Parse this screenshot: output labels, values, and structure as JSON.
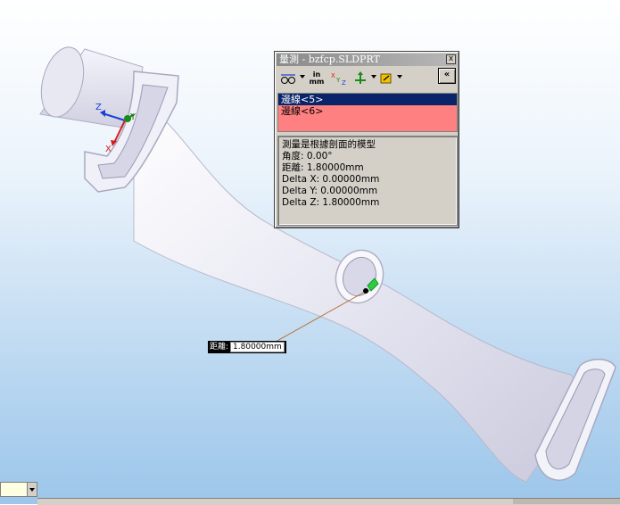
{
  "dialog": {
    "title": "量測 - bzfcp.SLDPRT",
    "close_glyph": "x",
    "collapse_glyph": "«",
    "toolbar": {
      "arc_icon": "arc-condition-icon",
      "units_label_top": "in",
      "units_label_bottom": "mm",
      "xyz_label": "XYZ",
      "projection_icon": "projection-icon",
      "coordinate_icon": "coordinate-system-icon"
    },
    "selections": [
      {
        "label": "邊線<5>",
        "selected": true
      },
      {
        "label": "邊線<6>",
        "selected": false
      }
    ],
    "results": [
      "測量是根據剖面的模型",
      "角度: 0.00°",
      "距離: 1.80000mm",
      "Delta X: 0.00000mm",
      "Delta Y: 0.00000mm",
      "Delta Z: 1.80000mm"
    ]
  },
  "callout": {
    "label": "距離:",
    "value": "1.80000mm"
  },
  "triad": {
    "x": "X",
    "y": "Y",
    "z": "Z"
  },
  "colors": {
    "selection_bg": "#ff8080",
    "selected_row": "#0a246a",
    "model": "#eeeef8"
  }
}
